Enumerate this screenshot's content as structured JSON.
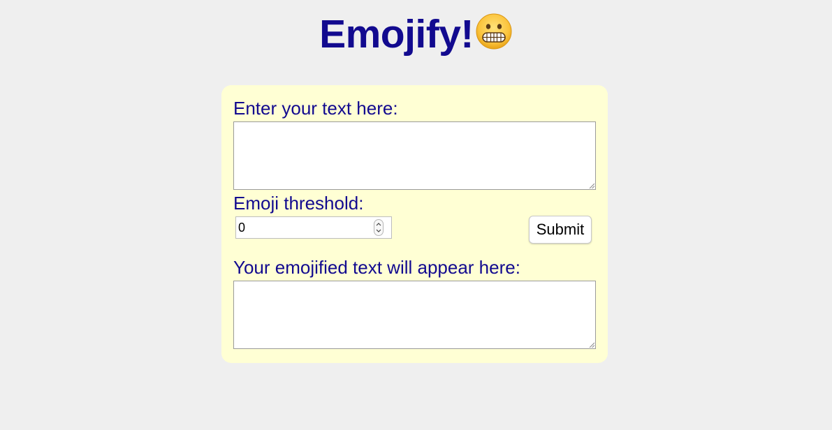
{
  "header": {
    "title": "Emojify!",
    "emoji_icon": "grimacing-face-emoji"
  },
  "form": {
    "input_label": "Enter your text here:",
    "input_value": "",
    "threshold_label": "Emoji threshold:",
    "threshold_value": "0",
    "submit_label": "Submit",
    "output_label": "Your emojified text will appear here:",
    "output_value": ""
  },
  "colors": {
    "page_background": "#efefef",
    "card_background": "#ffffd4",
    "text_color": "#120a8f"
  }
}
